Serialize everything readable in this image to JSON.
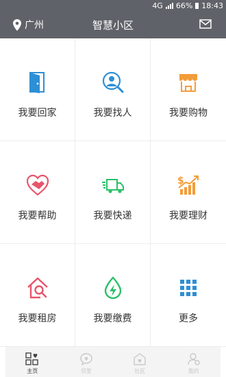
{
  "status": {
    "network": "4G",
    "battery": "66%",
    "time": "18:43"
  },
  "header": {
    "location": "广州",
    "title": "智慧小区",
    "location_icon": "map-pin-icon",
    "mail_icon": "mail-icon"
  },
  "grid": {
    "items": [
      {
        "label": "我要回家",
        "icon": "door-icon",
        "color": "#2d8fd5"
      },
      {
        "label": "我要找人",
        "icon": "search-person-icon",
        "color": "#2d8fd5"
      },
      {
        "label": "我要购物",
        "icon": "store-icon",
        "color": "#f39c3a"
      },
      {
        "label": "我要帮助",
        "icon": "handshake-heart-icon",
        "color": "#e8556b"
      },
      {
        "label": "我要快递",
        "icon": "delivery-truck-icon",
        "color": "#2bc069"
      },
      {
        "label": "我要理财",
        "icon": "finance-chart-icon",
        "color": "#f39c3a"
      },
      {
        "label": "我要租房",
        "icon": "rent-house-icon",
        "color": "#e8556b"
      },
      {
        "label": "我要缴费",
        "icon": "payment-drop-icon",
        "color": "#2bc069"
      },
      {
        "label": "更多",
        "icon": "grid-more-icon",
        "color": "#2d8fd5"
      }
    ]
  },
  "tabbar": {
    "tabs": [
      {
        "label": "主页",
        "icon": "home-grid-icon",
        "active": true
      },
      {
        "label": "邻里",
        "icon": "neighbor-chat-icon",
        "active": false
      },
      {
        "label": "社区",
        "icon": "community-house-icon",
        "active": false
      },
      {
        "label": "我的",
        "icon": "profile-icon",
        "active": false
      }
    ]
  }
}
